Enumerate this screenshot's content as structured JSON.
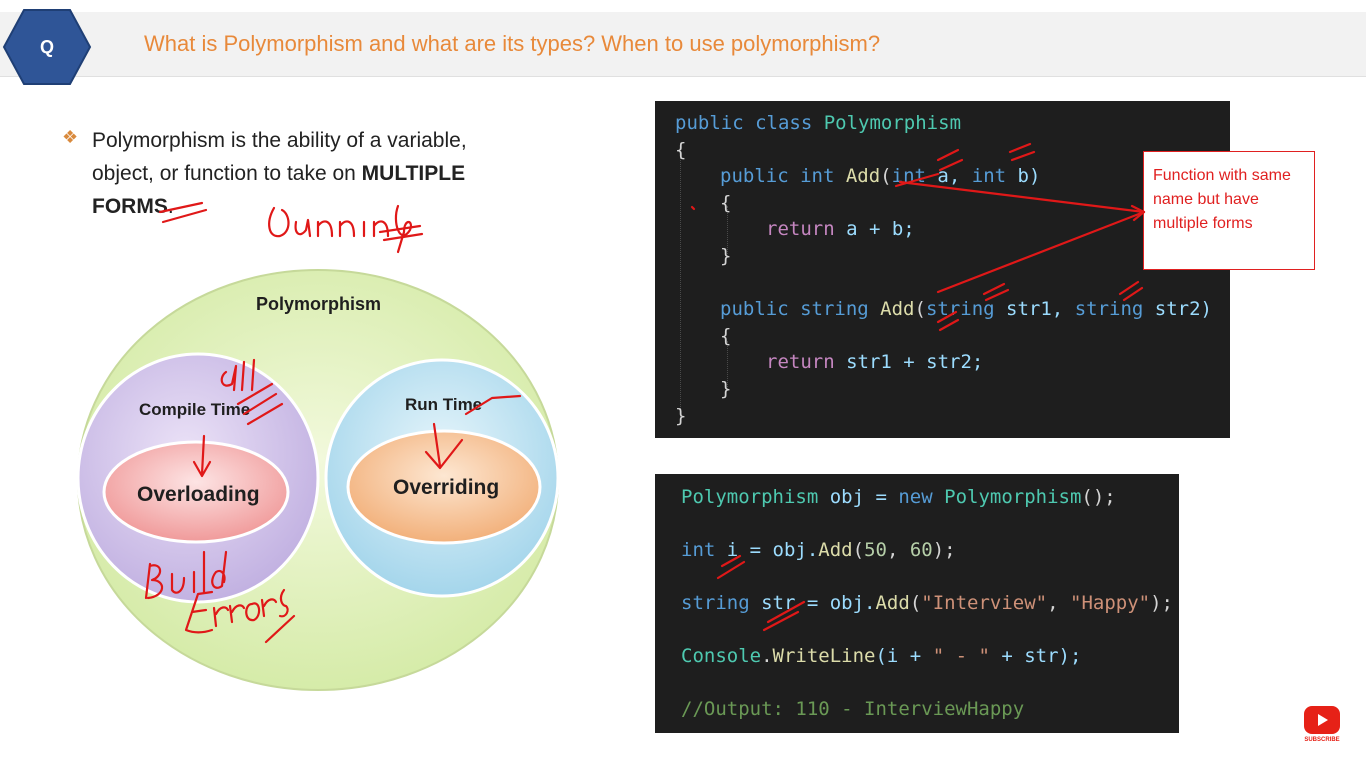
{
  "header": {
    "badge": "Q",
    "title": "What is Polymorphism and what are its types? When to use polymorphism?"
  },
  "bullet": {
    "text_plain": "Polymorphism is the ability of a variable, object, or function to take on ",
    "text_bold_1": "MULTIPLE",
    "text_bold_2": "FORMS",
    "text_end": "."
  },
  "diagram": {
    "outer": "Polymorphism",
    "left_circle": "Compile Time",
    "left_inner": "Overloading",
    "right_circle": "Run Time",
    "right_inner": "Overriding",
    "colors": {
      "outer": "#dff0b8",
      "left": "#d4c4ec",
      "left_inner": "#f4a8a8",
      "right": "#bfe4f2",
      "right_inner": "#f6c08e"
    }
  },
  "annotations": {
    "running": "Running",
    "dll": "dll",
    "build": "Build",
    "errors": "Errors"
  },
  "code_top": {
    "class_kw": "public class",
    "class_name": "Polymorphism",
    "open_brace": "{",
    "m1_mods": "public int",
    "m1_name": "Add",
    "m1_p1_type": "int",
    "m1_p1_name": "a,",
    "m1_p2_type": "int",
    "m1_p2_name": "b)",
    "m1_body": "return",
    "m1_expr": "a + b;",
    "m2_mods": "public string",
    "m2_name": "Add",
    "m2_p1_type": "string",
    "m2_p1_name": "str1,",
    "m2_p2_type": "string",
    "m2_p2_name": "str2)",
    "m2_body": "return",
    "m2_expr": "str1 + str2;",
    "close_brace": "}"
  },
  "callout": {
    "text": "Function with same name but have multiple forms"
  },
  "code_bottom": {
    "line1_type": "Polymorphism",
    "line1_rest": " obj = ",
    "line1_new": "new",
    "line1_ctor": "Polymorphism",
    "line1_end": "();",
    "line2_type": "int",
    "line2_rest": " i = obj.",
    "line2_fn": "Add",
    "line2_open": "(",
    "line2_n1": "50",
    "line2_sep": ", ",
    "line2_n2": "60",
    "line2_end": ");",
    "line3_type": "string",
    "line3_rest": " str = obj.",
    "line3_fn": "Add",
    "line3_open": "(",
    "line3_s1": "\"Interview\"",
    "line3_sep": ", ",
    "line3_s2": "\"Happy\"",
    "line3_end": ");",
    "line4_cls": "Console",
    "line4_dot": ".",
    "line4_fn": "WriteLine",
    "line4_rest1": "(i + ",
    "line4_str": "\" - \"",
    "line4_rest2": " + str);",
    "line5": "//Output: 110 - InterviewHappy"
  },
  "youtube": {
    "label": "SUBSCRIBE"
  }
}
